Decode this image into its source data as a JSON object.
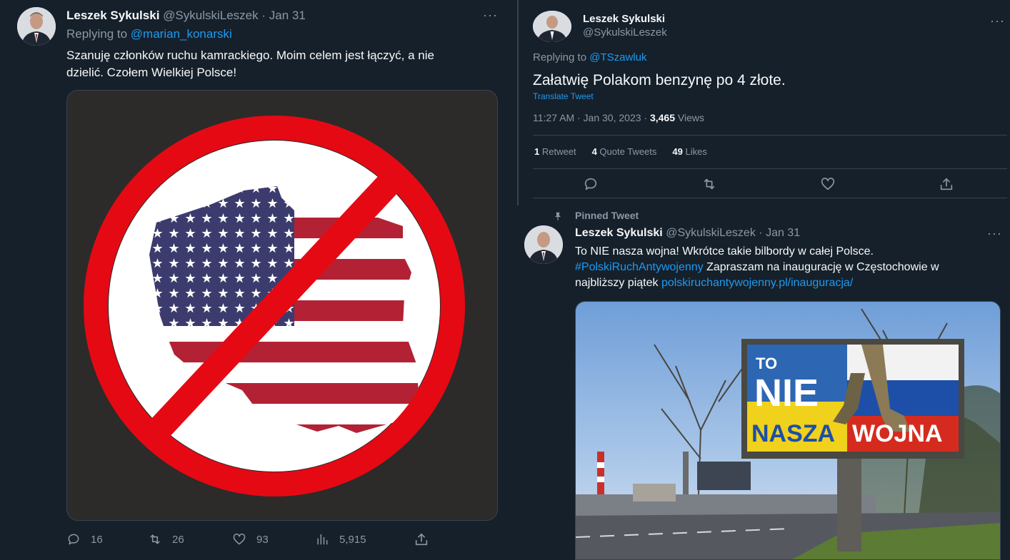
{
  "left_tweet": {
    "author_name": "Leszek Sykulski",
    "author_handle": "@SykulskiLeszek",
    "date_sep": "·",
    "date": "Jan 31",
    "replying_prefix": "Replying to",
    "replying_to": "@marian_konarski",
    "text_line1": "Szanuję członków ruchu kamrackiego. Moim celem jest łączyć, a nie",
    "text_line2": "dzielić. Czołem Wielkiej Polsce!",
    "actions": {
      "replies": "16",
      "retweets": "26",
      "likes": "93",
      "views": "5,915"
    },
    "image": {
      "ring_color": "#e50914",
      "background": "#2d2a2a"
    }
  },
  "right_top_tweet": {
    "author_name": "Leszek Sykulski",
    "author_handle": "@SykulskiLeszek",
    "replying_prefix": "Replying to",
    "replying_to": "@TSzawluk",
    "text": "Załatwię Polakom benzynę po 4 złote.",
    "translate": "Translate Tweet",
    "time": "11:27 AM · Jan 30, 2023 ·",
    "views_count": "3,465",
    "views_label": "Views",
    "stats": {
      "retweets_count": "1",
      "retweets_label": "Retweet",
      "quotes_count": "4",
      "quotes_label": "Quote Tweets",
      "likes_count": "49",
      "likes_label": "Likes"
    }
  },
  "pinned_tweet": {
    "pinned_label": "Pinned Tweet",
    "author_name": "Leszek Sykulski",
    "author_handle": "@SykulskiLeszek",
    "date_sep": "·",
    "date": "Jan 31",
    "text_line1": "To NIE nasza wojna! Wkrótce takie bilbordy w całej Polsce.",
    "hashtag": "#PolskiRuchAntywojenny",
    "text_line2_rest": " Zapraszam na inaugurację w Częstochowie w",
    "text_line3_prefix": "najbliższy piątek ",
    "url": "polskiruchantywojenny.pl/inauguracja/",
    "billboard": {
      "word1": "TO",
      "word2": "NIE",
      "word3a": "NASZA",
      "word3b": "WOJNA"
    }
  },
  "colors": {
    "accent": "#1d9bf0",
    "background": "#15202b",
    "text": "#f7f9f9",
    "muted": "#8b98a5"
  }
}
